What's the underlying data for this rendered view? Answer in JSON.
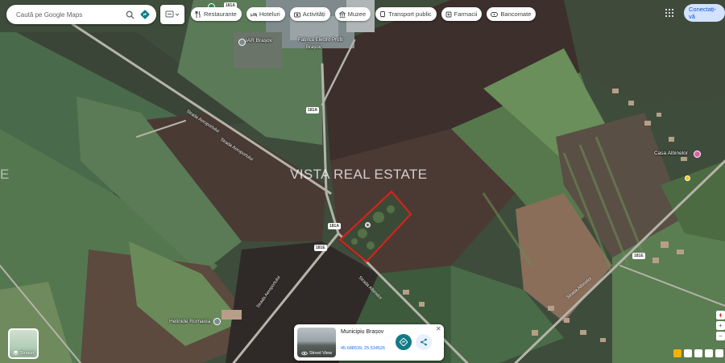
{
  "search": {
    "placeholder": "Caută pe Google Maps"
  },
  "chips": [
    {
      "label": "Restaurante",
      "icon": "fork-knife-icon"
    },
    {
      "label": "Hoteluri",
      "icon": "bed-icon"
    },
    {
      "label": "Activități",
      "icon": "camera-icon"
    },
    {
      "label": "Muzee",
      "icon": "museum-icon"
    },
    {
      "label": "Transport public",
      "icon": "train-icon"
    },
    {
      "label": "Farmacii",
      "icon": "pill-icon"
    },
    {
      "label": "Bancomate",
      "icon": "atm-icon"
    }
  ],
  "account": {
    "connect_label": "Conectați-vă"
  },
  "watermark": {
    "text": "VISTA REAL ESTATE",
    "left_fragment": "E"
  },
  "map_labels": {
    "airport": "IAR Brașov",
    "factory": "Fabrica Electro Profil",
    "factory_2": "Brașov",
    "casa": "Casa Albinelor",
    "helinide": "Helinide Romania",
    "road_shields": [
      "181A",
      "181A",
      "181A",
      "181E",
      "181E"
    ],
    "street_1": "Strada Aeroportului",
    "street_2": "Strada Aeroportului",
    "street_3": "Strada Albinelor",
    "street_4": "Strada Albinelor",
    "street_5": "Strada Aeroportului"
  },
  "info_card": {
    "title": "Municipiu Brașov",
    "coords": "45.688539, 25.534526",
    "street_view_label": "Street View"
  },
  "layers": {
    "label": "Straturi"
  },
  "colors": {
    "accent": "#1a73e8",
    "parcel_outline": "#e0201a",
    "directions_button": "#127a88",
    "connect_bg": "#d3e3fd"
  }
}
